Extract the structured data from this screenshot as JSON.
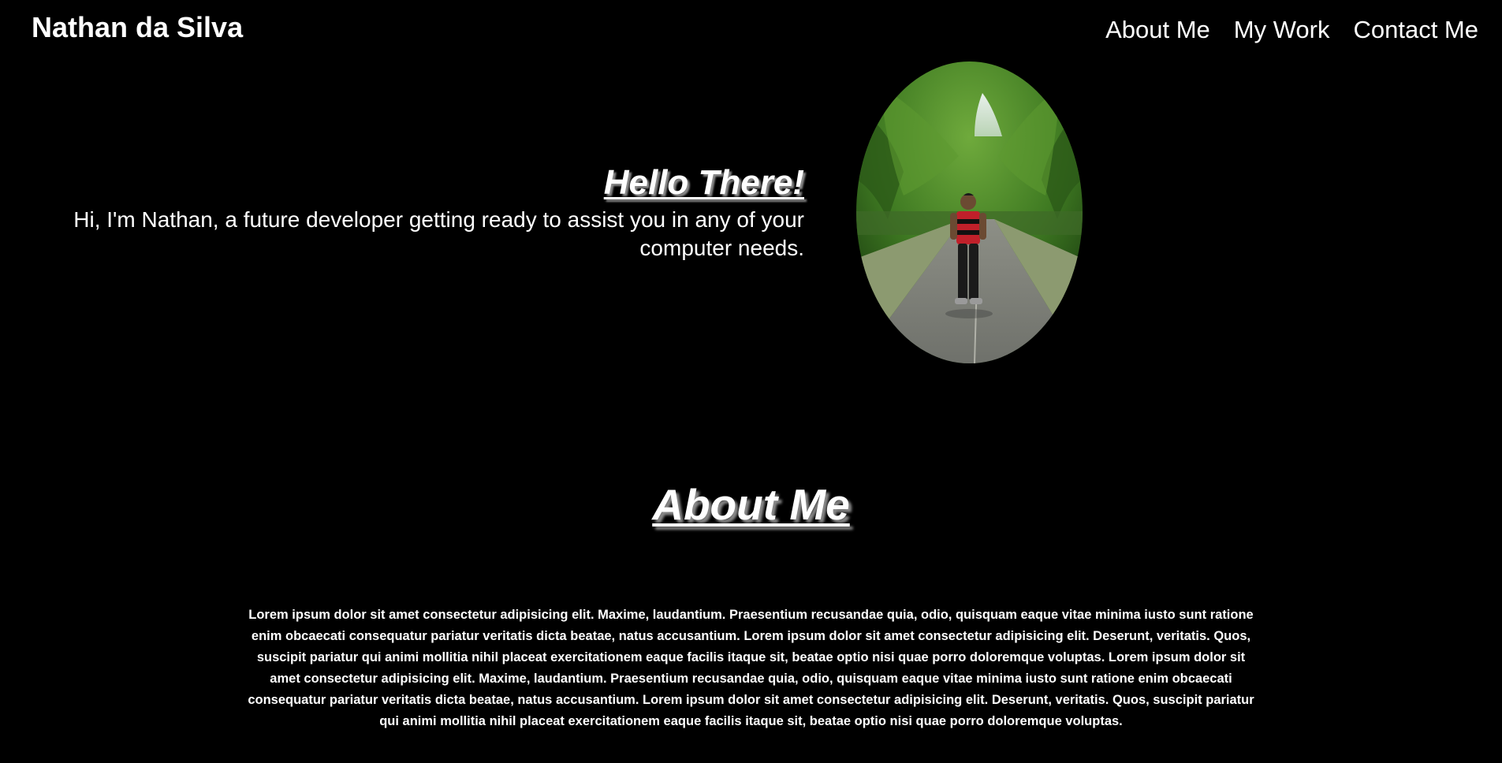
{
  "header": {
    "brand": "Nathan da Silva",
    "nav": {
      "about": "About Me",
      "work": "My Work",
      "contact": "Contact Me"
    }
  },
  "hero": {
    "title": "Hello There!",
    "subtitle": "Hi, I'm Nathan, a future developer getting ready to assist you in any of your computer needs."
  },
  "about": {
    "title": "About Me",
    "body": "Lorem ipsum dolor sit amet consectetur adipisicing elit. Maxime, laudantium. Praesentium recusandae quia, odio, quisquam eaque vitae minima iusto sunt ratione enim obcaecati consequatur pariatur veritatis dicta beatae, natus accusantium. Lorem ipsum dolor sit amet consectetur adipisicing elit. Deserunt, veritatis. Quos, suscipit pariatur qui animi mollitia nihil placeat exercitationem eaque facilis itaque sit, beatae optio nisi quae porro doloremque voluptas. Lorem ipsum dolor sit amet consectetur adipisicing elit. Maxime, laudantium. Praesentium recusandae quia, odio, quisquam eaque vitae minima iusto sunt ratione enim obcaecati consequatur pariatur veritatis dicta beatae, natus accusantium. Lorem ipsum dolor sit amet consectetur adipisicing elit. Deserunt, veritatis. Quos, suscipit pariatur qui animi mollitia nihil placeat exercitationem eaque facilis itaque sit, beatae optio nisi quae porro doloremque voluptas."
  },
  "colors": {
    "background": "#000000",
    "text": "#ffffff",
    "shadow": "#8a8a8a"
  }
}
